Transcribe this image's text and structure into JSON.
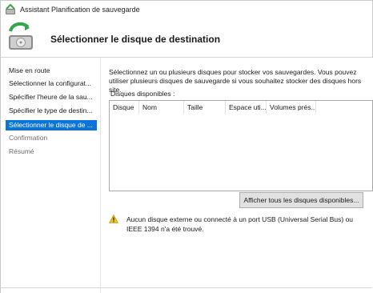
{
  "window": {
    "title": "Assistant Planification de sauvegarde"
  },
  "header": {
    "title": "Sélectionner le disque de destination",
    "icon": "backup-disk-icon"
  },
  "nav": {
    "items": [
      {
        "label": "Mise en route",
        "state": "normal"
      },
      {
        "label": "Sélectionner la configurat...",
        "state": "normal"
      },
      {
        "label": "Spécifier l'heure de la sau...",
        "state": "normal"
      },
      {
        "label": "Spécifier le type de destin...",
        "state": "normal"
      },
      {
        "label": "Sélectionner le disque de ...",
        "state": "active"
      },
      {
        "label": "Confirmation",
        "state": "disabled"
      },
      {
        "label": "Résumé",
        "state": "disabled"
      }
    ]
  },
  "main": {
    "intro_line1": "Sélectionnez un ou plusieurs disques pour stocker vos sauvegardes. Vous pouvez",
    "intro_line2": "utiliser plusieurs disques de sauvegarde si vous souhaitez stocker des disques hors site.",
    "disks_label": "Disques disponibles :",
    "columns": [
      "Disque",
      "Nom",
      "Taille",
      "Espace uti...",
      "Volumes prés..."
    ],
    "rows": [],
    "show_all_button": "Afficher tous les disques disponibles...",
    "warning_line1": "Aucun disque externe ou connecté à un port USB (Universal Serial Bus) ou",
    "warning_line2": "IEEE 1394 n'a été trouvé."
  },
  "colors": {
    "accent": "#0a74d8",
    "warning": "#f2c31b"
  }
}
